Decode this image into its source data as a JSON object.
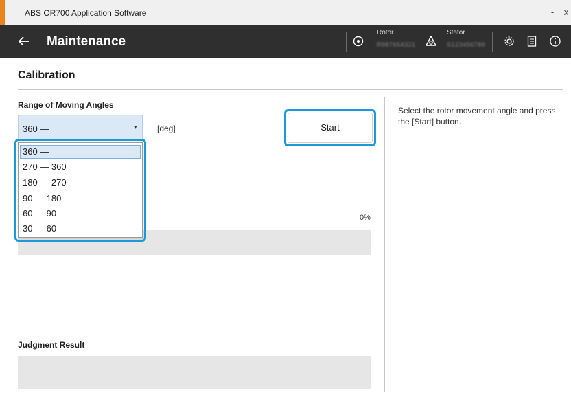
{
  "window": {
    "title": "ABS OR700 Application Software",
    "minimize": "-",
    "close": "x",
    "accent_color": "#e8821e"
  },
  "header": {
    "back_icon": "arrow-left-icon",
    "page_title": "Maintenance",
    "rotor_label": "Rotor",
    "rotor_value": "R987654321",
    "stator_label": "Stator",
    "stator_value": "S123456789",
    "icons": [
      "rotor-icon",
      "stator-icon",
      "gear-icon",
      "document-icon",
      "info-icon"
    ]
  },
  "calibration": {
    "section_title": "Calibration",
    "range_label": "Range of Moving Angles",
    "selected_range": "360 —",
    "unit": "[deg]",
    "start_label": "Start",
    "help_text": "Select the rotor movement angle and press the [Start] button.",
    "progress_text": "0%",
    "judgment_label": "Judgment Result",
    "options": [
      "360 —",
      "270 — 360",
      "180 — 270",
      "90 — 180",
      "60 — 90",
      "30 — 60"
    ],
    "selected_index": 0
  },
  "colors": {
    "header_bg": "#2f2f2f",
    "focus_ring": "#1a9ad6",
    "select_bg": "#dbe8f5"
  }
}
